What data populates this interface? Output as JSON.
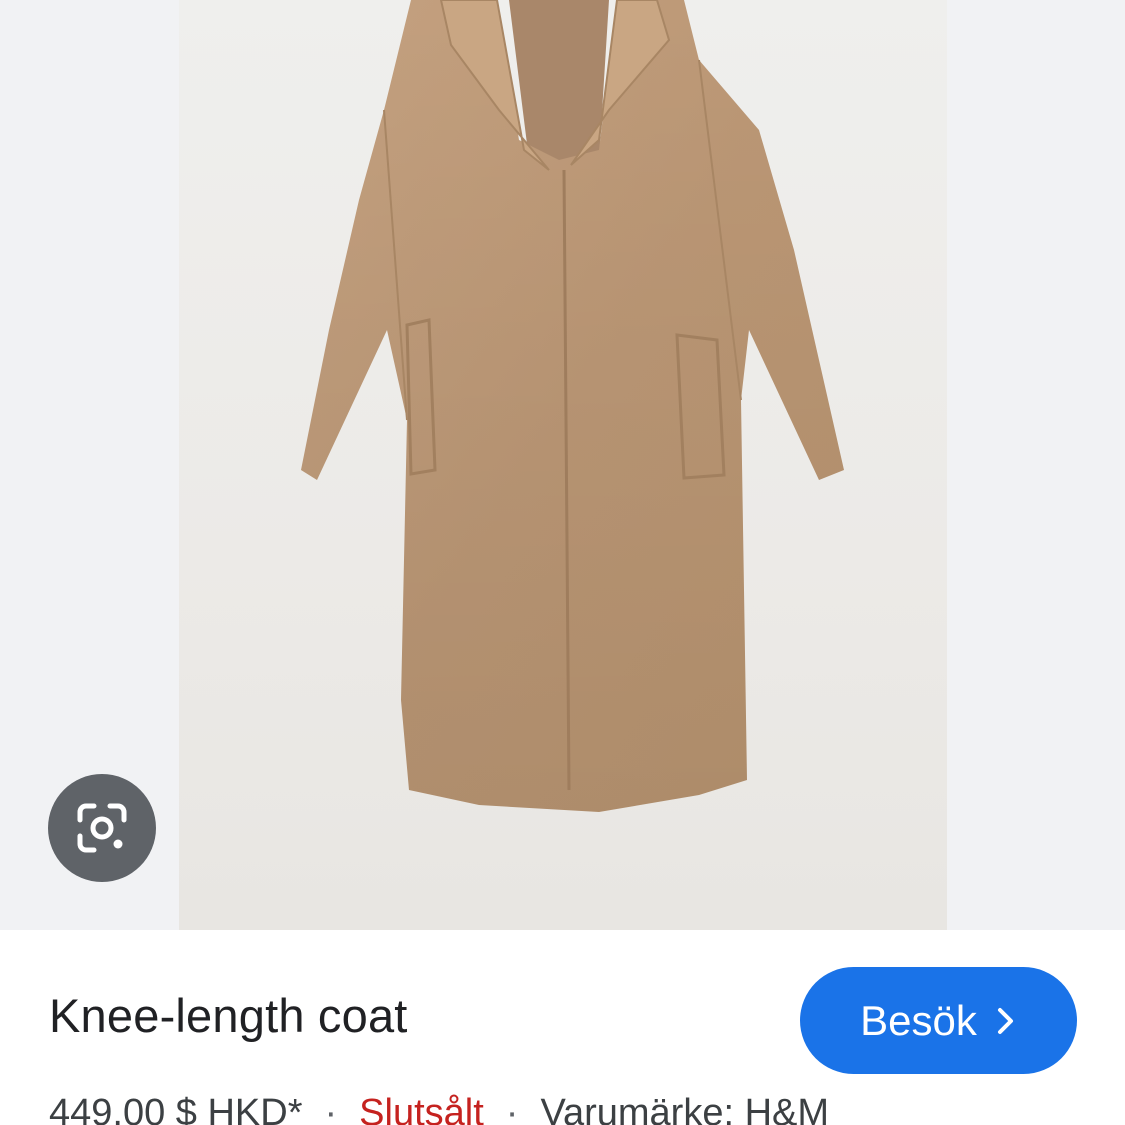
{
  "product": {
    "title": "Knee-length coat",
    "visit_label": "Besök",
    "price": "449,00 $ HKD*",
    "separator": "·",
    "availability": "Slutsålt",
    "brand": "Varumärke: H&M"
  },
  "colors": {
    "accent": "#1a73e8",
    "sold_out": "#c5221f",
    "lens_button": "#5f6368",
    "coat": "#bd9a78"
  },
  "icons": {
    "lens": "google-lens-icon",
    "chevron": "chevron-right-icon"
  }
}
